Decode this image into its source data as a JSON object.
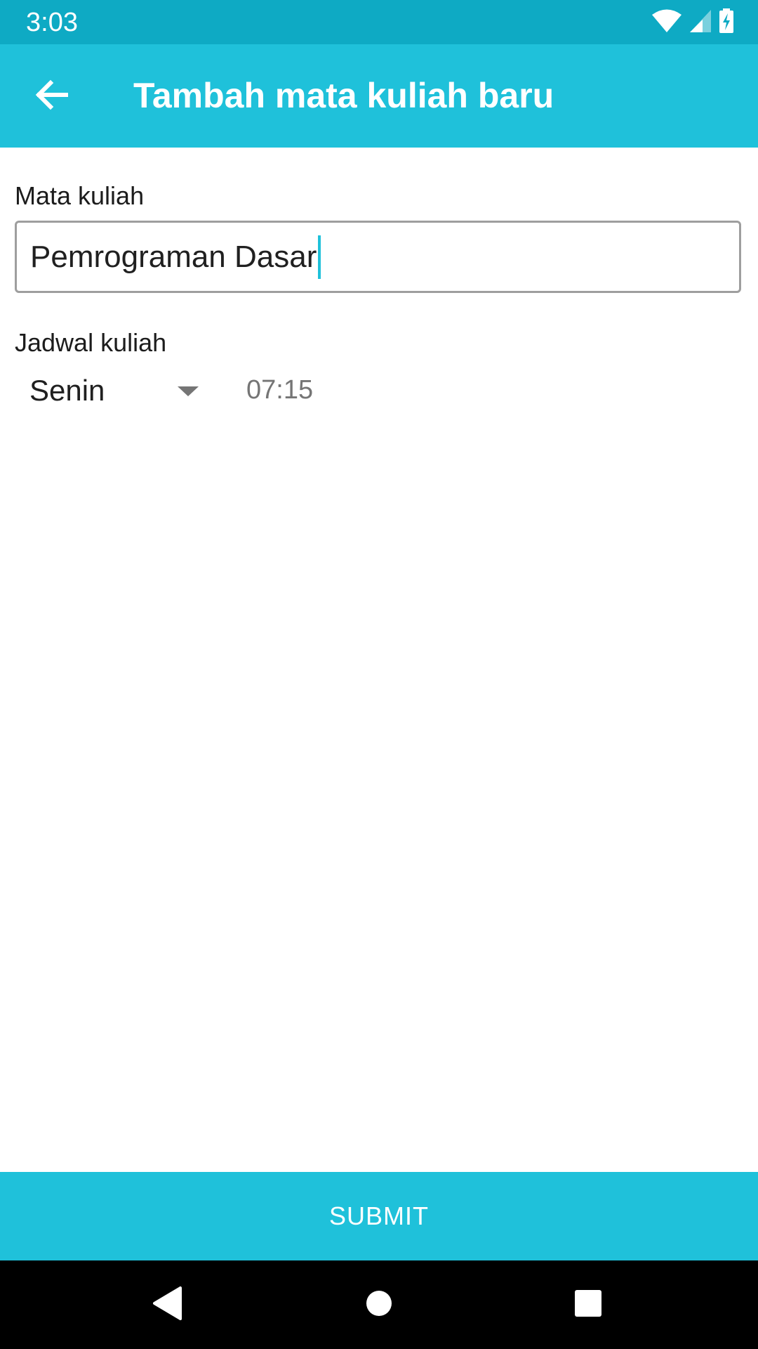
{
  "status_bar": {
    "time": "3:03",
    "icons": [
      "wifi-icon",
      "cellular-signal-icon",
      "battery-charging-icon"
    ]
  },
  "app_bar": {
    "back_icon": "arrow-left-icon",
    "title": "Tambah mata kuliah baru"
  },
  "form": {
    "course_label": "Mata kuliah",
    "course_value": "Pemrograman Dasar",
    "schedule_label": "Jadwal kuliah",
    "day_selected": "Senin",
    "time_value": "07:15"
  },
  "submit": {
    "label": "SUBMIT"
  },
  "nav_bar": {
    "icons": [
      "nav-back-icon",
      "nav-home-icon",
      "nav-recents-icon"
    ]
  },
  "colors": {
    "status_bar": "#0eaac4",
    "primary": "#1fc1da",
    "text": "#202020",
    "hint": "#757575"
  }
}
